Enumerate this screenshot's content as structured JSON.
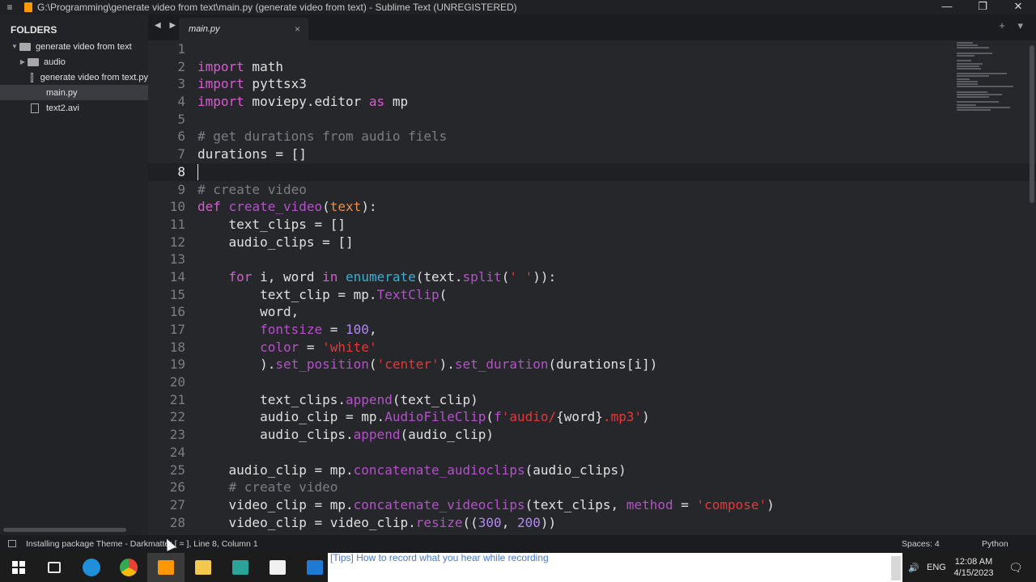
{
  "window": {
    "title": "G:\\Programming\\generate video from text\\main.py (generate video from text) - Sublime Text (UNREGISTERED)",
    "minimize": "—",
    "maximize": "❐",
    "close": "✕"
  },
  "sidebar": {
    "header": "FOLDERS",
    "items": [
      {
        "label": "generate video from text",
        "type": "folder",
        "expanded": true
      },
      {
        "label": "audio",
        "type": "folder",
        "expanded": false
      },
      {
        "label": "generate video from text.py",
        "type": "file"
      },
      {
        "label": "main.py",
        "type": "file",
        "selected": true
      },
      {
        "label": "text2.avi",
        "type": "file"
      }
    ]
  },
  "tabbar": {
    "nav_arrows": "◀ ▶",
    "tab_label": "main.py",
    "tab_close": "×",
    "right_controls": "+ ▾"
  },
  "editor": {
    "current_line": 8,
    "line_numbers": [
      "1",
      "2",
      "3",
      "4",
      "5",
      "6",
      "7",
      "8",
      "9",
      "10",
      "11",
      "12",
      "13",
      "14",
      "15",
      "16",
      "17",
      "18",
      "19",
      "20",
      "21",
      "22",
      "23",
      "24",
      "25",
      "26",
      "27",
      "28"
    ]
  },
  "statusbar": {
    "status_text": "Installing package Theme - Darkmatter [  =  ], Line 8, Column 1",
    "spaces": "Spaces: 4",
    "syntax": "Python"
  },
  "taskbar": {
    "browser_snippet": "[Tips] How to record what you hear while recording",
    "lang": "ENG",
    "time": "12:08 AM",
    "date": "4/15/2023",
    "volume_icon": "🔊",
    "tray_arrow": "^",
    "notification_icon": "🗨"
  },
  "icons": {
    "windows": "windows-start-icon",
    "task_view": "task-view-icon",
    "edge": "edge-browser-icon",
    "chrome": "chrome-browser-icon",
    "sublime": "sublime-text-icon",
    "explorer": "file-explorer-icon",
    "app6": "app-icon",
    "app7": "app-icon",
    "vscode": "vscode-icon"
  },
  "colors": {
    "keyword": "#d65cd0",
    "comment": "#7b7d82",
    "function": "#b451c9",
    "string": "#e43838",
    "number": "#b089f0",
    "builtin": "#38b0d5",
    "param": "#e88f4d"
  }
}
